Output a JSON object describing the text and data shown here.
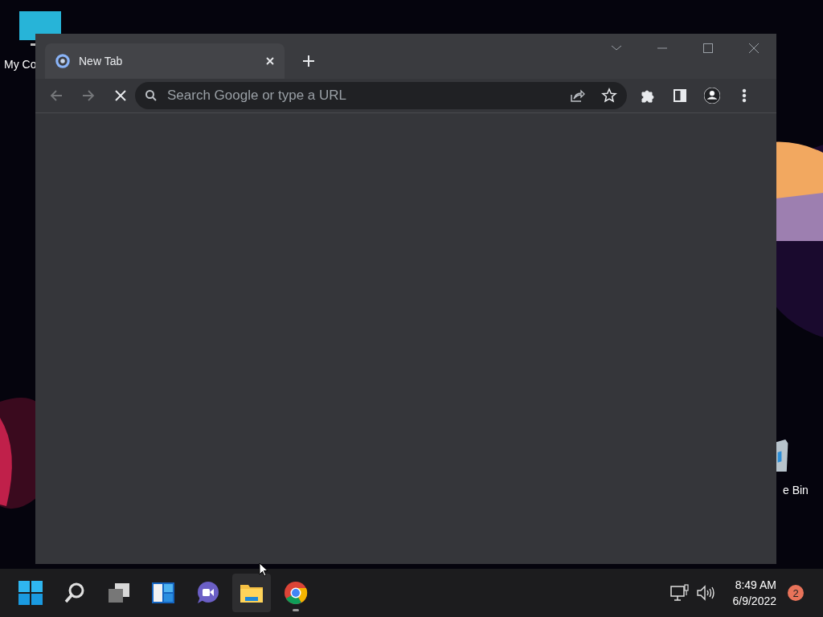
{
  "desktop": {
    "icons": [
      {
        "kind": "computer",
        "label": "My Co"
      },
      {
        "kind": "recycle",
        "label": "e Bin"
      }
    ]
  },
  "browser": {
    "tabs": [
      {
        "title": "New Tab",
        "selected": true
      }
    ],
    "nav": {
      "back_disabled": true,
      "forward_disabled": true,
      "loading": true
    },
    "address_bar": {
      "placeholder": "Search Google or type a URL"
    }
  },
  "taskbar": {
    "apps": [
      {
        "kind": "start",
        "active": false,
        "running": false
      },
      {
        "kind": "search",
        "active": false,
        "running": false
      },
      {
        "kind": "taskview",
        "active": false,
        "running": false
      },
      {
        "kind": "widgets",
        "active": false,
        "running": false
      },
      {
        "kind": "chat",
        "active": false,
        "running": false
      },
      {
        "kind": "explorer",
        "active": true,
        "running": false
      },
      {
        "kind": "chrome",
        "active": false,
        "running": true
      }
    ],
    "clock": {
      "time": "8:49 AM",
      "date": "6/9/2022"
    },
    "notification_count": "2"
  }
}
